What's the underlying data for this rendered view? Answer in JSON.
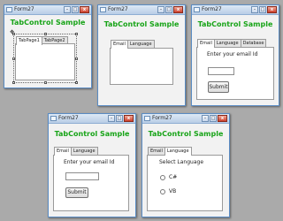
{
  "windows": [
    {
      "title": "Form27",
      "heading": "TabControl Sample",
      "tabs": [
        "TabPage1",
        "TabPage2"
      ],
      "controls": {
        "minimize": "–",
        "maximize": "□",
        "close": "x"
      },
      "design_glyph": "✥"
    },
    {
      "title": "Form27",
      "heading": "TabControl Sample",
      "tabs": [
        "Email",
        "Language"
      ],
      "controls": {
        "minimize": "–",
        "maximize": "□",
        "close": "x"
      }
    },
    {
      "title": "Form27",
      "heading": "TabControl Sample",
      "tabs": [
        "Email",
        "Language",
        "Database"
      ],
      "email_label": "Enter your email Id",
      "submit_label": "Submit",
      "controls": {
        "minimize": "–",
        "maximize": "□",
        "close": "x"
      }
    },
    {
      "title": "Form27",
      "heading": "TabControl Sample",
      "tabs": [
        "Email",
        "Language"
      ],
      "email_label": "Enter your email Id",
      "submit_label": "Submit",
      "controls": {
        "minimize": "–",
        "maximize": "□",
        "close": "x"
      }
    },
    {
      "title": "Form27",
      "heading": "TabControl Sample",
      "tabs": [
        "Email",
        "Language"
      ],
      "language_label": "Select Language",
      "options": [
        "C#",
        "VB"
      ],
      "controls": {
        "minimize": "–",
        "maximize": "□",
        "close": "x"
      }
    }
  ]
}
